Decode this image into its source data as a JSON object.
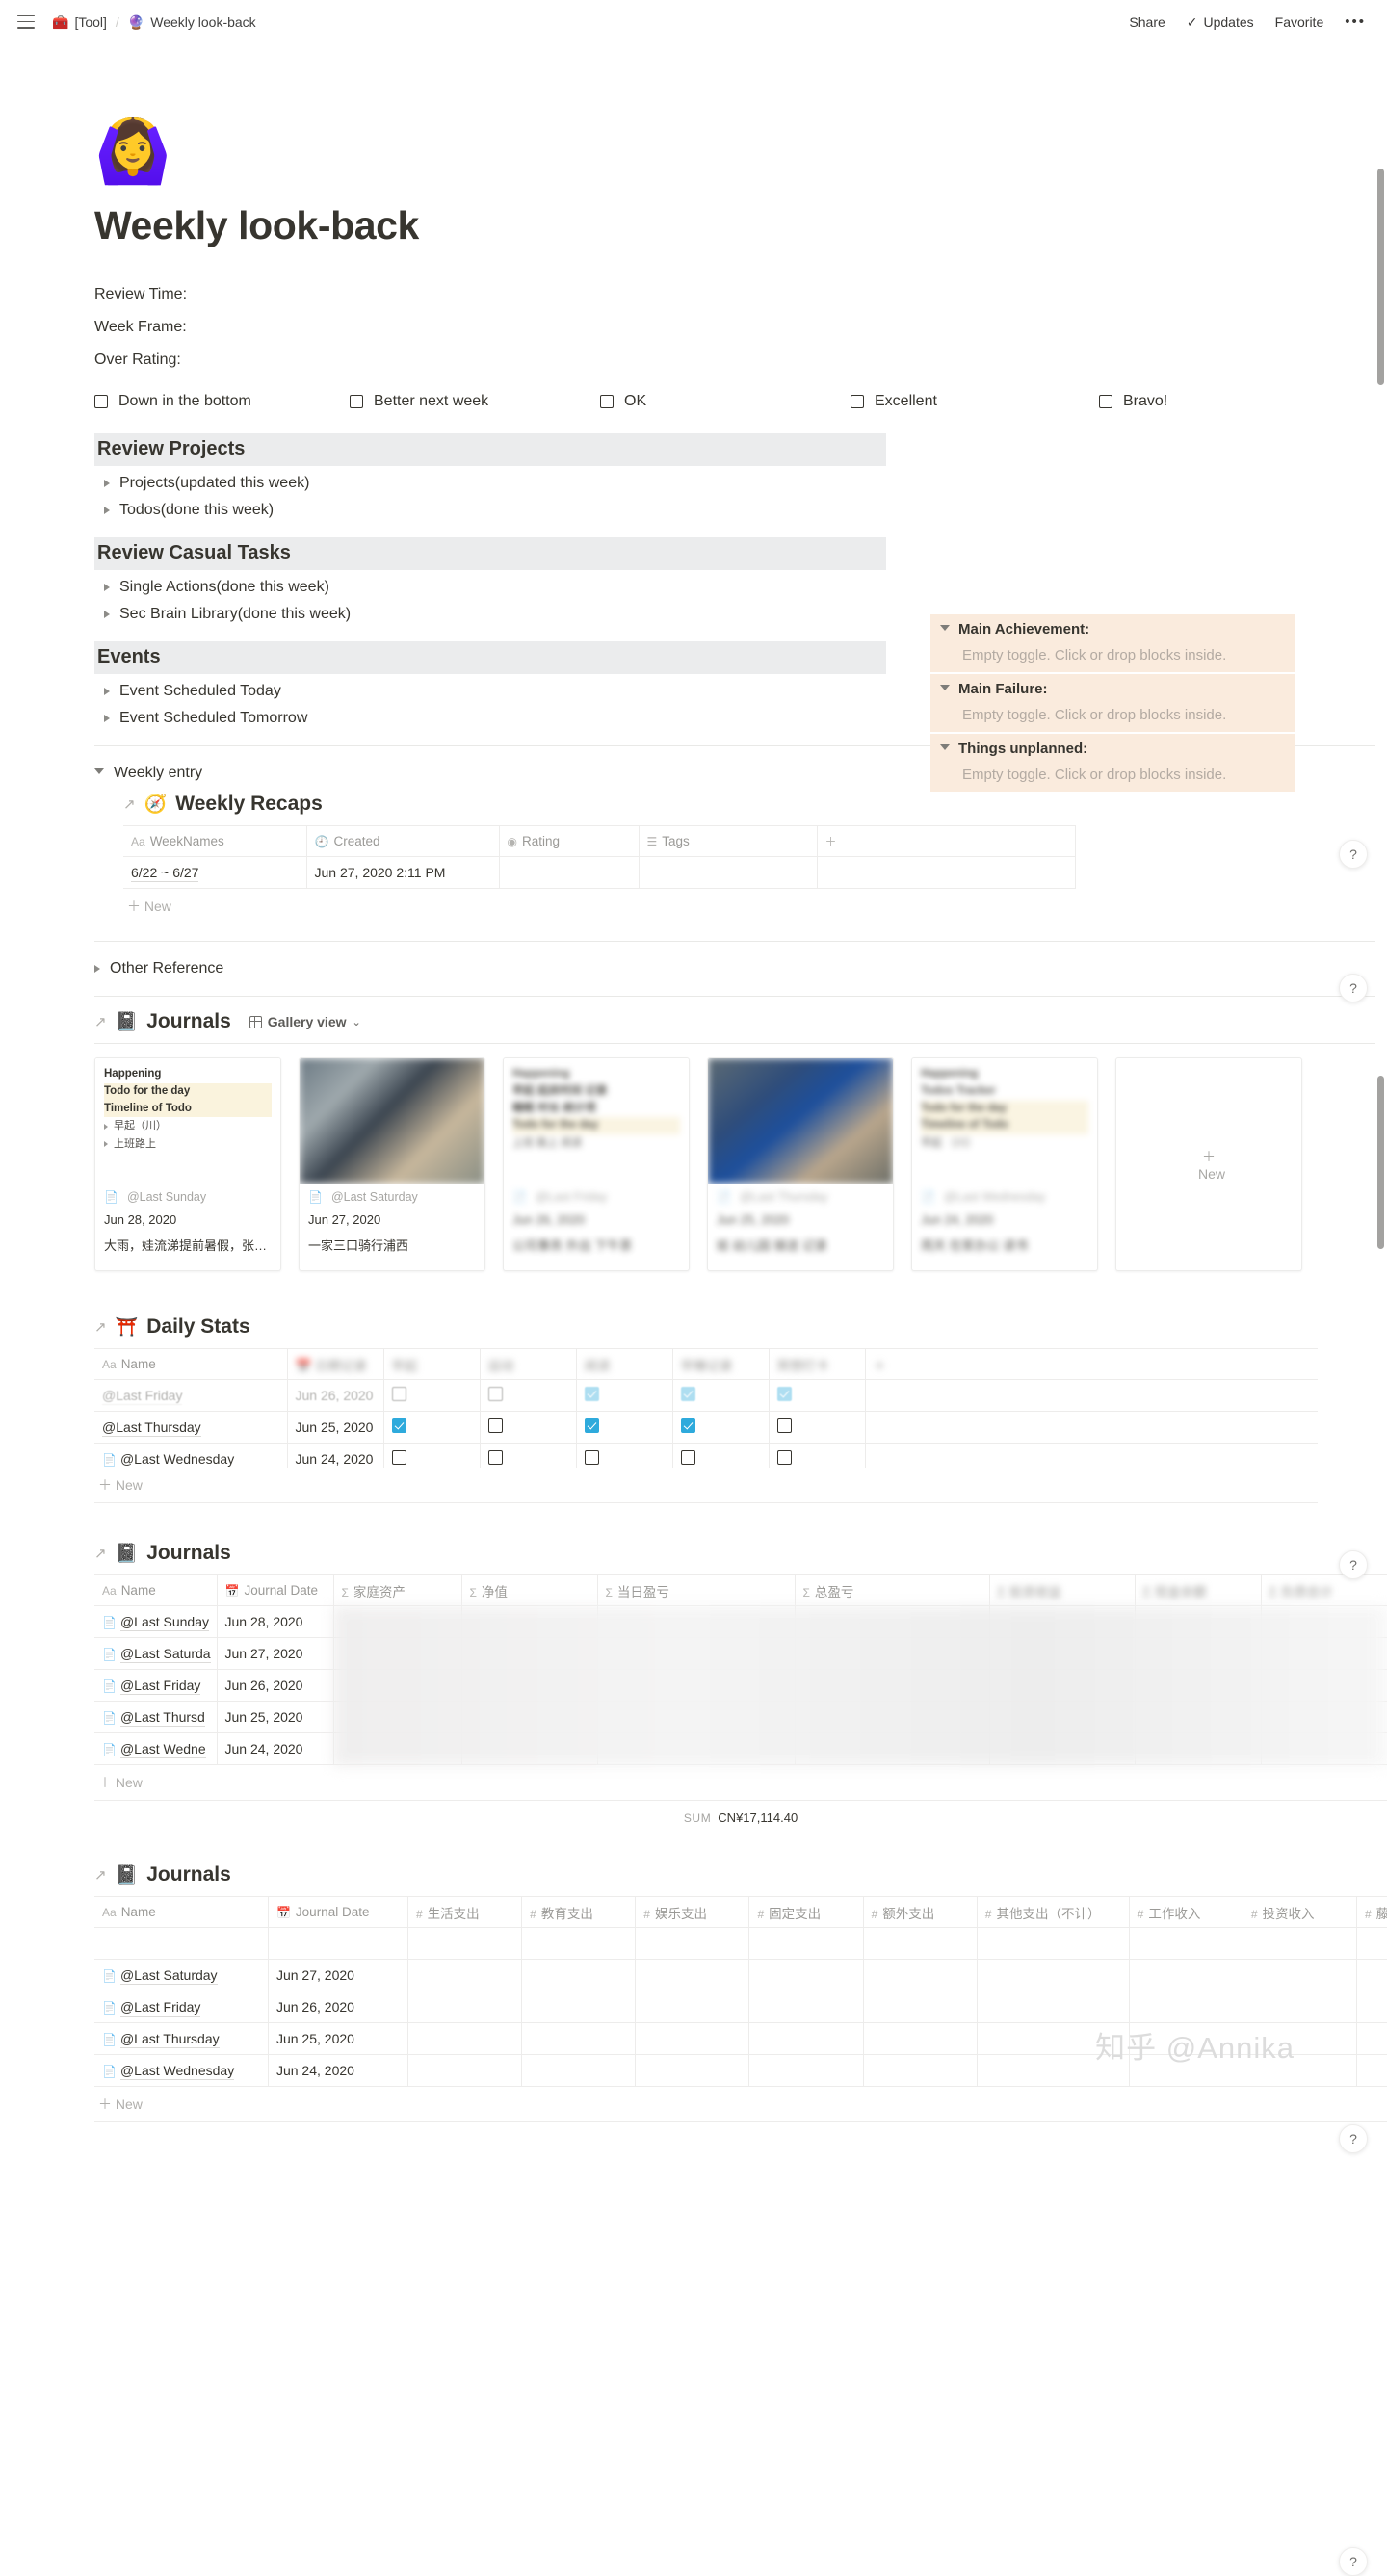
{
  "topbar": {
    "breadcrumb": [
      {
        "icon": "🧰",
        "label": "[Tool]"
      },
      {
        "icon": "🔮",
        "label": "Weekly look-back"
      }
    ],
    "separator": "/",
    "share_label": "Share",
    "updates_label": "Updates",
    "favorite_label": "Favorite",
    "more_label": "•••"
  },
  "page": {
    "emoji": "🙆‍♀️",
    "title": "Weekly look-back",
    "meta": [
      "Review Time:",
      "Week Frame:",
      "Over Rating:"
    ],
    "ratings": [
      "Down in the bottom",
      "Better next week",
      "OK",
      "Excellent",
      "Bravo!"
    ]
  },
  "sections": [
    {
      "heading": "Review Projects",
      "toggles": [
        "Projects(updated this week)",
        "Todos(done this week)"
      ]
    },
    {
      "heading": "Review Casual Tasks",
      "toggles": [
        "Single Actions(done this week)",
        "Sec Brain Library(done this week)"
      ]
    },
    {
      "heading": "Events",
      "toggles": [
        "Event Scheduled Today",
        "Event Scheduled Tomorrow"
      ]
    }
  ],
  "callouts": [
    {
      "title": "Main Achievement:",
      "empty": "Empty toggle. Click or drop blocks inside."
    },
    {
      "title": "Main Failure:",
      "empty": "Empty toggle. Click or drop blocks inside."
    },
    {
      "title": "Things unplanned:",
      "empty": "Empty toggle. Click or drop blocks inside."
    }
  ],
  "weekly_entry": {
    "toggle_label": "Weekly entry",
    "db_title": "Weekly Recaps",
    "db_emoji": "🧭",
    "columns": [
      "WeekNames",
      "Created",
      "Rating",
      "Tags"
    ],
    "column_icons": [
      "Aa",
      "clock-icon",
      "rating-icon",
      "list-icon"
    ],
    "rows": [
      {
        "weekname": "6/22 ~ 6/27",
        "created": "Jun 27, 2020 2:11 PM",
        "rating": "",
        "tags": ""
      }
    ],
    "new_label": "New"
  },
  "other_reference": {
    "toggle_label": "Other Reference"
  },
  "journals_gallery": {
    "db_title": "Journals",
    "db_emoji": "📓",
    "view_label": "Gallery view",
    "cards": [
      {
        "preview": [
          "Happening",
          "Todo for the day",
          "Timeline of Todo"
        ],
        "sub": [
          "早起（川）",
          "上班路上"
        ],
        "name": "@Last Sunday",
        "date": "Jun 28, 2020",
        "desc": "大雨，娃流涕提前暑假，张江…"
      },
      {
        "preview": [],
        "sub": [],
        "name": "@Last Saturday",
        "date": "Jun 27, 2020",
        "desc": "一家三口骑行浦西"
      },
      {
        "preview": [],
        "sub": [],
        "name": "@Last Friday",
        "date": "Jun 26, 2020",
        "desc": ""
      },
      {
        "preview": [],
        "sub": [],
        "name": "@Last Thursday",
        "date": "Jun 25, 2020",
        "desc": ""
      },
      {
        "preview": [],
        "sub": [],
        "name": "@Last Wednesday",
        "date": "Jun 24, 2020",
        "desc": ""
      }
    ],
    "new_label": "New"
  },
  "daily_stats": {
    "db_title": "Daily Stats",
    "db_emoji": "⛩️",
    "columns": [
      "Name",
      "",
      "",
      "",
      "",
      "",
      "",
      ""
    ],
    "rows": [
      {
        "name": "@Last Friday",
        "date": "Jun 26, 2020",
        "checks": [
          false,
          false,
          true,
          true,
          true
        ],
        "faded": true
      },
      {
        "name": "@Last Thursday",
        "date": "Jun 25, 2020",
        "checks": [
          true,
          false,
          true,
          true,
          false
        ],
        "faded": false
      },
      {
        "name": "@Last Wednesday",
        "date": "Jun 24, 2020",
        "checks": [
          false,
          false,
          false,
          false,
          false
        ],
        "faded": false
      }
    ],
    "new_label": "New"
  },
  "journals_finance": {
    "db_title": "Journals",
    "db_emoji": "📓",
    "columns": [
      "Name",
      "Journal Date",
      "家庭资产",
      "净值",
      "当日盈亏",
      "总盈亏"
    ],
    "rows": [
      {
        "name": "@Last Sunday",
        "date": "Jun 28, 2020"
      },
      {
        "name": "@Last Saturda",
        "date": "Jun 27, 2020"
      },
      {
        "name": "@Last Friday",
        "date": "Jun 26, 2020"
      },
      {
        "name": "@Last Thursd",
        "date": "Jun 25, 2020"
      },
      {
        "name": "@Last Wedne",
        "date": "Jun 24, 2020"
      }
    ],
    "new_label": "New",
    "sum_label": "SUM",
    "sum_value": "CN¥17,114.40"
  },
  "journals_expense": {
    "db_title": "Journals",
    "db_emoji": "📓",
    "columns": [
      "Name",
      "Journal Date",
      "生活支出",
      "教育支出",
      "娱乐支出",
      "固定支出",
      "额外支出",
      "其他支出（不计）",
      "工作收入",
      "投资收入",
      "藤妈自主"
    ],
    "rows": [
      {
        "name": "@Last Saturday",
        "date": "Jun 27, 2020"
      },
      {
        "name": "@Last Friday",
        "date": "Jun 26, 2020"
      },
      {
        "name": "@Last Thursday",
        "date": "Jun 25, 2020"
      },
      {
        "name": "@Last Wednesday",
        "date": "Jun 24, 2020"
      }
    ],
    "new_label": "New"
  },
  "help_label": "?",
  "watermark": "知乎 @Annika",
  "colors": {
    "callout_bg": "#faebdd",
    "section_bg": "#ebeced",
    "checkbox_on": "#2eaadc",
    "highlight": "#faf3dd"
  }
}
